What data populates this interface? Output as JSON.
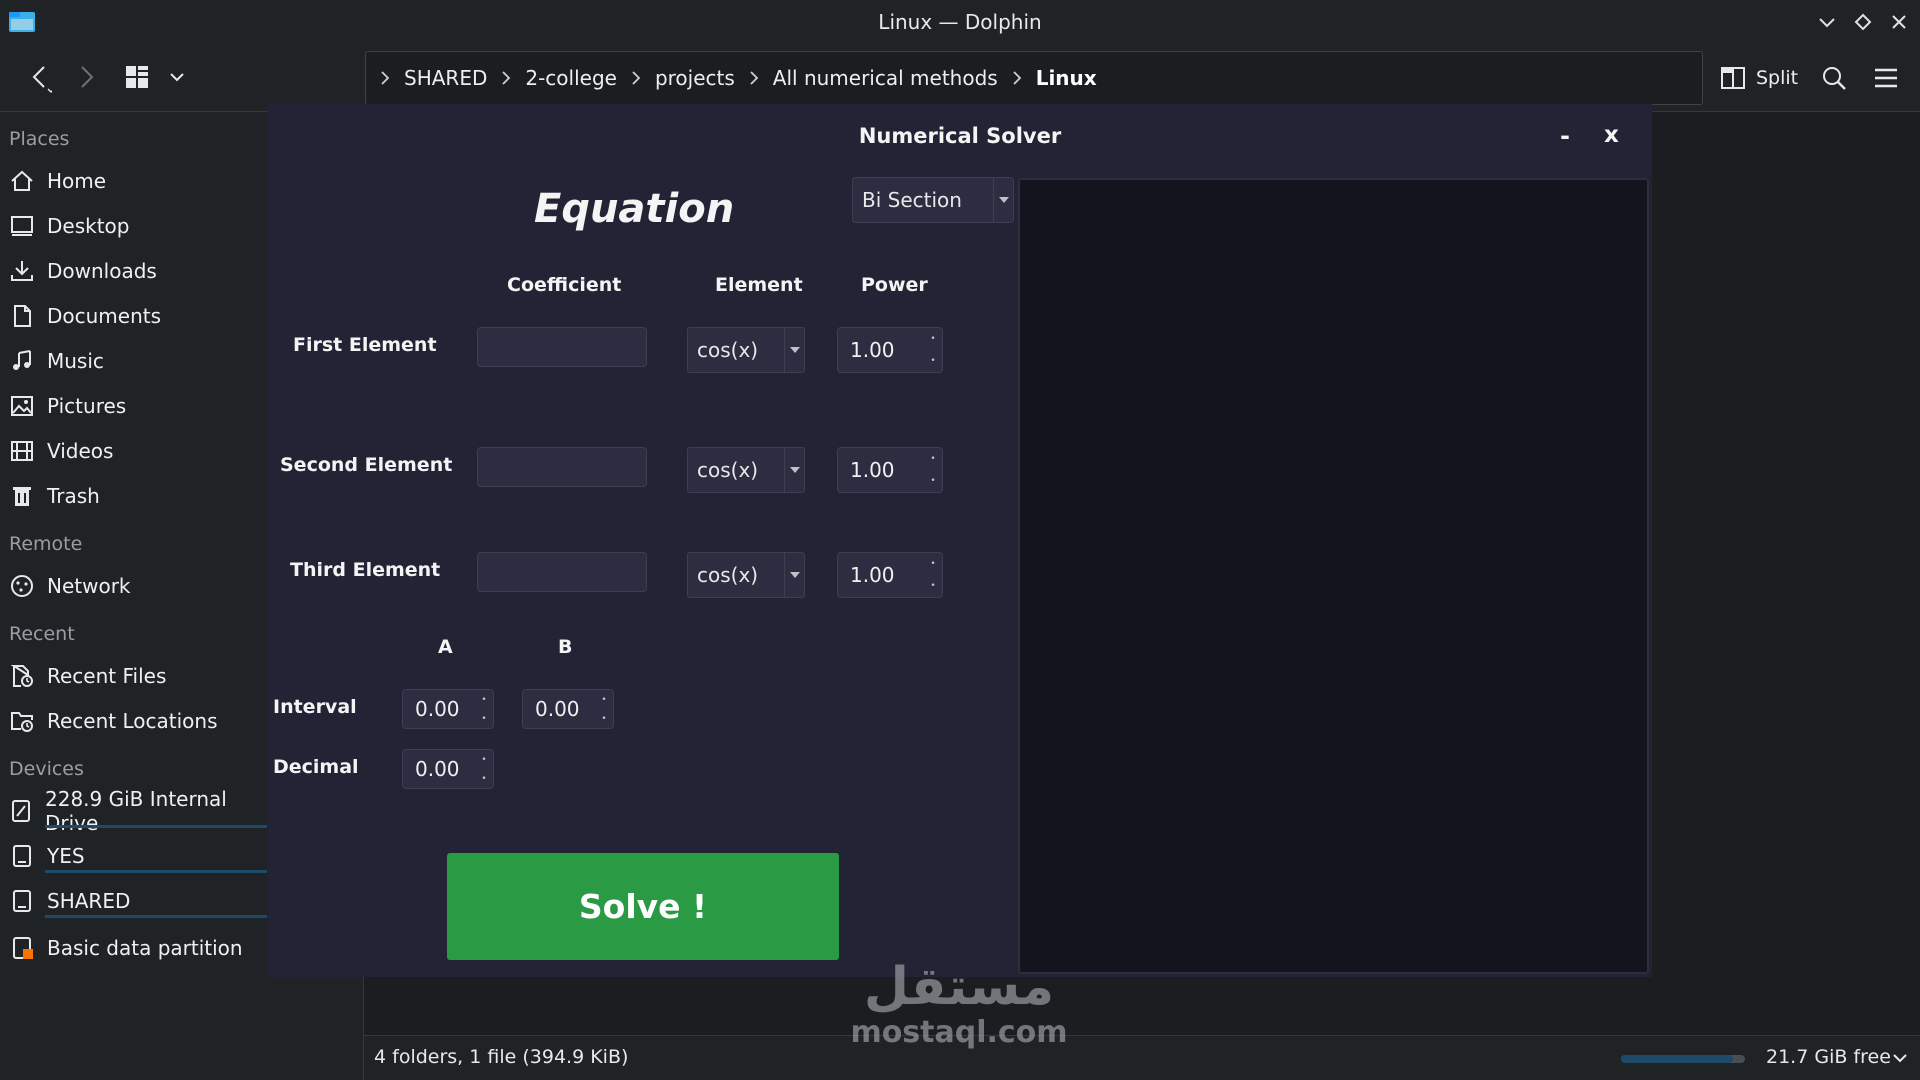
{
  "window": {
    "title": "Linux — Dolphin"
  },
  "toolbar": {
    "breadcrumb": [
      "SHARED",
      "2-college",
      "projects",
      "All numerical methods",
      "Linux"
    ],
    "split_label": "Split"
  },
  "sidebar": {
    "places_heading": "Places",
    "places": [
      "Home",
      "Desktop",
      "Downloads",
      "Documents",
      "Music",
      "Pictures",
      "Videos",
      "Trash"
    ],
    "remote_heading": "Remote",
    "remote": [
      "Network"
    ],
    "recent_heading": "Recent",
    "recent": [
      "Recent Files",
      "Recent Locations"
    ],
    "devices_heading": "Devices",
    "devices": [
      "228.9 GiB Internal Drive",
      "YES",
      "SHARED",
      "Basic data partition"
    ]
  },
  "status": {
    "summary": "4 folders, 1 file (394.9 KiB)",
    "free_space": "21.7 GiB free",
    "used_fraction": 0.9
  },
  "solver": {
    "title": "Numerical Solver",
    "minimize": "-",
    "close": "x",
    "heading": "Equation",
    "method": "Bi Section",
    "columns": {
      "coefficient": "Coefficient",
      "element": "Element",
      "power": "Power"
    },
    "rows": [
      {
        "label": "First Element",
        "coefficient": "",
        "element": "cos(x)",
        "power": "1.00"
      },
      {
        "label": "Second Element",
        "coefficient": "",
        "element": "cos(x)",
        "power": "1.00"
      },
      {
        "label": "Third Element",
        "coefficient": "",
        "element": "cos(x)",
        "power": "1.00"
      }
    ],
    "interval": {
      "a_label": "A",
      "b_label": "B",
      "label": "Interval",
      "a": "0.00",
      "b": "0.00"
    },
    "decimal": {
      "label": "Decimal",
      "value": "0.00"
    },
    "solve_label": "Solve !"
  },
  "watermark": {
    "arabic": "مستقل",
    "latin": "mostaql.com"
  }
}
